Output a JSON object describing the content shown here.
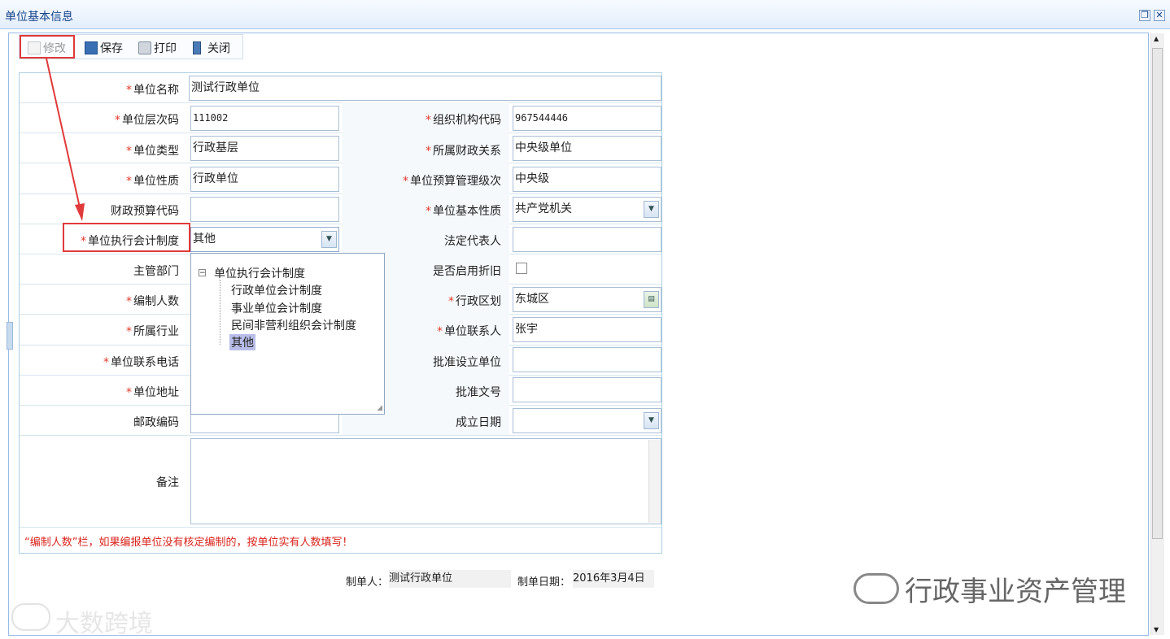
{
  "window": {
    "title": "单位基本信息",
    "restore_icon": "restore-icon",
    "close_icon": "close-icon"
  },
  "toolbar": {
    "edit_label": "修改",
    "save_label": "保存",
    "print_label": "打印",
    "close_label": "关闭"
  },
  "form": {
    "unit_name": {
      "label": "单位名称",
      "value": "测试行政单位"
    },
    "level_code": {
      "label": "单位层次码",
      "value": "111002"
    },
    "org_code": {
      "label": "组织机构代码",
      "value": "967544446"
    },
    "unit_type": {
      "label": "单位类型",
      "value": "行政基层"
    },
    "finance_relation": {
      "label": "所属财政关系",
      "value": "中央级单位"
    },
    "unit_nature": {
      "label": "单位性质",
      "value": "行政单位"
    },
    "budget_level": {
      "label": "单位预算管理级次",
      "value": "中央级"
    },
    "budget_code": {
      "label": "财政预算代码",
      "value": ""
    },
    "basic_nature": {
      "label": "单位基本性质",
      "value": "共产党机关"
    },
    "accounting_system": {
      "label": "单位执行会计制度",
      "value": "其他"
    },
    "legal_rep": {
      "label": "法定代表人",
      "value": ""
    },
    "department": {
      "label": "主管部门",
      "value": ""
    },
    "depreciation": {
      "label": "是否启用折旧"
    },
    "staff_count": {
      "label": "编制人数",
      "value": ""
    },
    "district": {
      "label": "行政区划",
      "value": "东城区"
    },
    "industry": {
      "label": "所属行业",
      "value": ""
    },
    "contact": {
      "label": "单位联系人",
      "value": "张宇"
    },
    "phone": {
      "label": "单位联系电话",
      "value": ""
    },
    "approve_unit": {
      "label": "批准设立单位",
      "value": ""
    },
    "address": {
      "label": "单位地址",
      "value": ""
    },
    "approve_doc": {
      "label": "批准文号",
      "value": ""
    },
    "postcode": {
      "label": "邮政编码",
      "value": ""
    },
    "established": {
      "label": "成立日期",
      "value": ""
    },
    "remarks": {
      "label": "备注",
      "value": ""
    }
  },
  "required_mark": "*",
  "tree": {
    "root": "单位执行会计制度",
    "items": [
      "行政单位会计制度",
      "事业单位会计制度",
      "民间非营利组织会计制度",
      "其他"
    ],
    "selected": "其他"
  },
  "note": "“编制人数”栏，如果编报单位没有核定编制的，按单位实有人数填写！",
  "footer": {
    "maker_label": "制单人：",
    "maker_value": "测试行政单位",
    "date_label": "制单日期：",
    "date_value": "2016年3月4日"
  },
  "watermarks": {
    "bottom_left": "大数跨境",
    "bottom_right": "行政事业资产管理"
  },
  "colors": {
    "accent_red": "#e03a3a",
    "title_blue": "#15428b",
    "note_red": "#d8231b"
  }
}
